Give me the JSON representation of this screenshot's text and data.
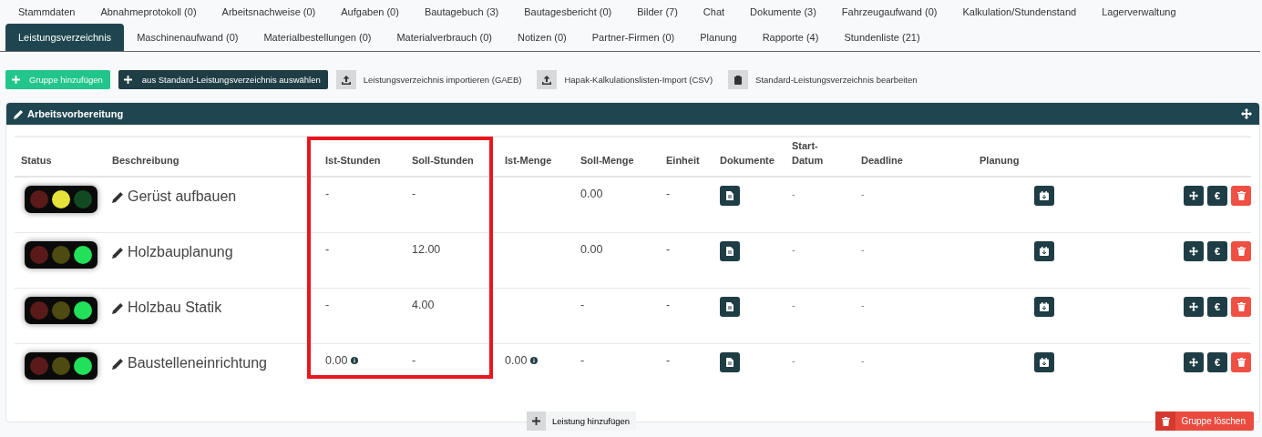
{
  "tabs_row_1": [
    {
      "label": "Stammdaten",
      "selected": false
    },
    {
      "label": "Abnahmeprotokoll (0)",
      "selected": false
    },
    {
      "label": "Arbeitsnachweise (0)",
      "selected": false
    },
    {
      "label": "Aufgaben (0)",
      "selected": false
    },
    {
      "label": "Bautagebuch (3)",
      "selected": false
    },
    {
      "label": "Bautagesbericht (0)",
      "selected": false
    },
    {
      "label": "Bilder (7)",
      "selected": false
    },
    {
      "label": "Chat",
      "selected": false
    },
    {
      "label": "Dokumente (3)",
      "selected": false
    },
    {
      "label": "Fahrzeugaufwand (0)",
      "selected": false
    },
    {
      "label": "Kalkulation/Stundenstand",
      "selected": false
    },
    {
      "label": "Lagerverwaltung",
      "selected": false
    }
  ],
  "tabs_row_2": [
    {
      "label": "Leistungsverzeichnis",
      "selected": true
    },
    {
      "label": "Maschinenaufwand (0)",
      "selected": false
    },
    {
      "label": "Materialbestellungen (0)",
      "selected": false
    },
    {
      "label": "Materialverbrauch (0)",
      "selected": false
    },
    {
      "label": "Notizen (0)",
      "selected": false
    },
    {
      "label": "Partner-Firmen (0)",
      "selected": false
    },
    {
      "label": "Planung",
      "selected": false
    },
    {
      "label": "Rapporte (4)",
      "selected": false
    },
    {
      "label": "Stundenliste (21)",
      "selected": false
    }
  ],
  "toolbar": [
    {
      "kind": "success",
      "label": "Gruppe hinzufügen"
    },
    {
      "kind": "dark",
      "label": "aus Standard-Leistungsverzeichnis auswählen"
    },
    {
      "kind": "light",
      "label": "Leistungsverzeichnis importieren (GAEB)"
    },
    {
      "kind": "light",
      "label": "Hapak-Kalkulationslisten-Import (CSV)"
    },
    {
      "kind": "light",
      "label": "Standard-Leistungsverzeichnis bearbeiten"
    }
  ],
  "group": {
    "title": "Arbeitsvorbereitung",
    "columns": [
      "Status",
      "Beschreibung",
      "Ist-Stunden",
      "Soll-Stunden",
      "Ist-Menge",
      "Soll-Menge",
      "Einheit",
      "Dokumente",
      "Start-\nDatum",
      "Deadline",
      "Planung"
    ],
    "rows": [
      {
        "lights": [
          {
            "on": false
          },
          {
            "on": true
          },
          {
            "on": false
          }
        ],
        "description": "Gerüst aufbauen",
        "ist_stunden": {
          "value": "-",
          "info": false
        },
        "soll_stunden": "-",
        "soll_menge": "0.00",
        "einheit": "-",
        "start_datum": "-",
        "deadline": "-"
      },
      {
        "lights": [
          {
            "on": false
          },
          {
            "on": false
          },
          {
            "on": true
          }
        ],
        "description": "Holzbauplanung",
        "ist_stunden": {
          "value": "-",
          "info": false
        },
        "soll_stunden": "12.00",
        "soll_menge": "0.00",
        "einheit": "-",
        "start_datum": "-",
        "deadline": "-"
      },
      {
        "lights": [
          {
            "on": false
          },
          {
            "on": false
          },
          {
            "on": true
          }
        ],
        "description": "Holzbau Statik",
        "ist_stunden": {
          "value": "-",
          "info": false
        },
        "soll_stunden": "4.00",
        "soll_menge": "-",
        "einheit": "-",
        "start_datum": "-",
        "deadline": "-"
      },
      {
        "lights": [
          {
            "on": false
          },
          {
            "on": false
          },
          {
            "on": true
          }
        ],
        "description": "Baustelleneinrichtung",
        "ist_stunden": {
          "value": "0.00",
          "info": true
        },
        "soll_stunden": "-",
        "ist_menge": {
          "value": "0.00",
          "info": true
        },
        "soll_menge": "-",
        "einheit": "-",
        "start_datum": "-",
        "deadline": "-"
      }
    ],
    "euro_label": "€",
    "add_button": "Leistung hinzufügen",
    "delete_button": "Gruppe löschen"
  }
}
